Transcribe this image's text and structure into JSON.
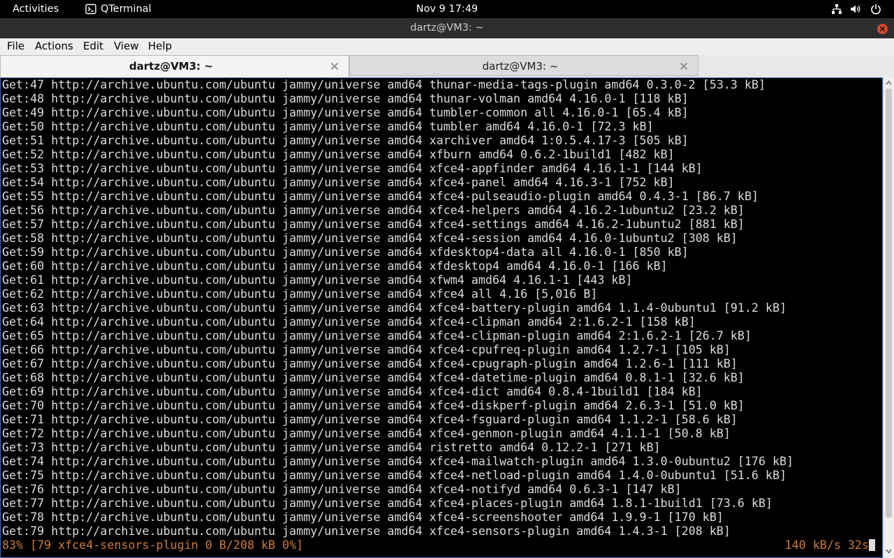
{
  "topbar": {
    "activities": "Activities",
    "app_name": "QTerminal",
    "clock": "Nov 9  17:49",
    "icons": [
      "network-icon",
      "volume-icon",
      "power-icon"
    ]
  },
  "window": {
    "title": "dartz@VM3: ~",
    "close_color": "#d1492f"
  },
  "menu": {
    "items": [
      "File",
      "Actions",
      "Edit",
      "View",
      "Help"
    ]
  },
  "tabs": [
    {
      "label": "dartz@VM3: ~",
      "active": true
    },
    {
      "label": "dartz@VM3: ~",
      "active": false
    }
  ],
  "terminal": {
    "lines": [
      "Get:47 http://archive.ubuntu.com/ubuntu jammy/universe amd64 thunar-media-tags-plugin amd64 0.3.0-2 [53.3 kB]",
      "Get:48 http://archive.ubuntu.com/ubuntu jammy/universe amd64 thunar-volman amd64 4.16.0-1 [118 kB]",
      "Get:49 http://archive.ubuntu.com/ubuntu jammy/universe amd64 tumbler-common all 4.16.0-1 [65.4 kB]",
      "Get:50 http://archive.ubuntu.com/ubuntu jammy/universe amd64 tumbler amd64 4.16.0-1 [72.3 kB]",
      "Get:51 http://archive.ubuntu.com/ubuntu jammy/universe amd64 xarchiver amd64 1:0.5.4.17-3 [505 kB]",
      "Get:52 http://archive.ubuntu.com/ubuntu jammy/universe amd64 xfburn amd64 0.6.2-1build1 [482 kB]",
      "Get:53 http://archive.ubuntu.com/ubuntu jammy/universe amd64 xfce4-appfinder amd64 4.16.1-1 [144 kB]",
      "Get:54 http://archive.ubuntu.com/ubuntu jammy/universe amd64 xfce4-panel amd64 4.16.3-1 [752 kB]",
      "Get:55 http://archive.ubuntu.com/ubuntu jammy/universe amd64 xfce4-pulseaudio-plugin amd64 0.4.3-1 [86.7 kB]",
      "Get:56 http://archive.ubuntu.com/ubuntu jammy/universe amd64 xfce4-helpers amd64 4.16.2-1ubuntu2 [23.2 kB]",
      "Get:57 http://archive.ubuntu.com/ubuntu jammy/universe amd64 xfce4-settings amd64 4.16.2-1ubuntu2 [881 kB]",
      "Get:58 http://archive.ubuntu.com/ubuntu jammy/universe amd64 xfce4-session amd64 4.16.0-1ubuntu2 [308 kB]",
      "Get:59 http://archive.ubuntu.com/ubuntu jammy/universe amd64 xfdesktop4-data all 4.16.0-1 [850 kB]",
      "Get:60 http://archive.ubuntu.com/ubuntu jammy/universe amd64 xfdesktop4 amd64 4.16.0-1 [166 kB]",
      "Get:61 http://archive.ubuntu.com/ubuntu jammy/universe amd64 xfwm4 amd64 4.16.1-1 [443 kB]",
      "Get:62 http://archive.ubuntu.com/ubuntu jammy/universe amd64 xfce4 all 4.16 [5,016 B]",
      "Get:63 http://archive.ubuntu.com/ubuntu jammy/universe amd64 xfce4-battery-plugin amd64 1.1.4-0ubuntu1 [91.2 kB]",
      "Get:64 http://archive.ubuntu.com/ubuntu jammy/universe amd64 xfce4-clipman amd64 2:1.6.2-1 [158 kB]",
      "Get:65 http://archive.ubuntu.com/ubuntu jammy/universe amd64 xfce4-clipman-plugin amd64 2:1.6.2-1 [26.7 kB]",
      "Get:66 http://archive.ubuntu.com/ubuntu jammy/universe amd64 xfce4-cpufreq-plugin amd64 1.2.7-1 [105 kB]",
      "Get:67 http://archive.ubuntu.com/ubuntu jammy/universe amd64 xfce4-cpugraph-plugin amd64 1.2.6-1 [111 kB]",
      "Get:68 http://archive.ubuntu.com/ubuntu jammy/universe amd64 xfce4-datetime-plugin amd64 0.8.1-1 [32.6 kB]",
      "Get:69 http://archive.ubuntu.com/ubuntu jammy/universe amd64 xfce4-dict amd64 0.8.4-1build1 [184 kB]",
      "Get:70 http://archive.ubuntu.com/ubuntu jammy/universe amd64 xfce4-diskperf-plugin amd64 2.6.3-1 [51.0 kB]",
      "Get:71 http://archive.ubuntu.com/ubuntu jammy/universe amd64 xfce4-fsguard-plugin amd64 1.1.2-1 [58.6 kB]",
      "Get:72 http://archive.ubuntu.com/ubuntu jammy/universe amd64 xfce4-genmon-plugin amd64 4.1.1-1 [50.8 kB]",
      "Get:73 http://archive.ubuntu.com/ubuntu jammy/universe amd64 ristretto amd64 0.12.2-1 [271 kB]",
      "Get:74 http://archive.ubuntu.com/ubuntu jammy/universe amd64 xfce4-mailwatch-plugin amd64 1.3.0-0ubuntu2 [176 kB]",
      "Get:75 http://archive.ubuntu.com/ubuntu jammy/universe amd64 xfce4-netload-plugin amd64 1.4.0-0ubuntu1 [51.6 kB]",
      "Get:76 http://archive.ubuntu.com/ubuntu jammy/universe amd64 xfce4-notifyd amd64 0.6.3-1 [147 kB]",
      "Get:77 http://archive.ubuntu.com/ubuntu jammy/universe amd64 xfce4-places-plugin amd64 1.8.1-1build1 [73.6 kB]",
      "Get:78 http://archive.ubuntu.com/ubuntu jammy/universe amd64 xfce4-screenshooter amd64 1.9.9-1 [170 kB]",
      "Get:79 http://archive.ubuntu.com/ubuntu jammy/universe amd64 xfce4-sensors-plugin amd64 1.4.3-1 [208 kB]"
    ],
    "progress_text": "83% [79 xfce4-sensors-plugin 0 B/208 kB 0%]",
    "rate_text": "140 kB/s 32s",
    "progress_color": "#cc7a3a",
    "text_color": "#dcdcdc",
    "background": "#000000"
  }
}
